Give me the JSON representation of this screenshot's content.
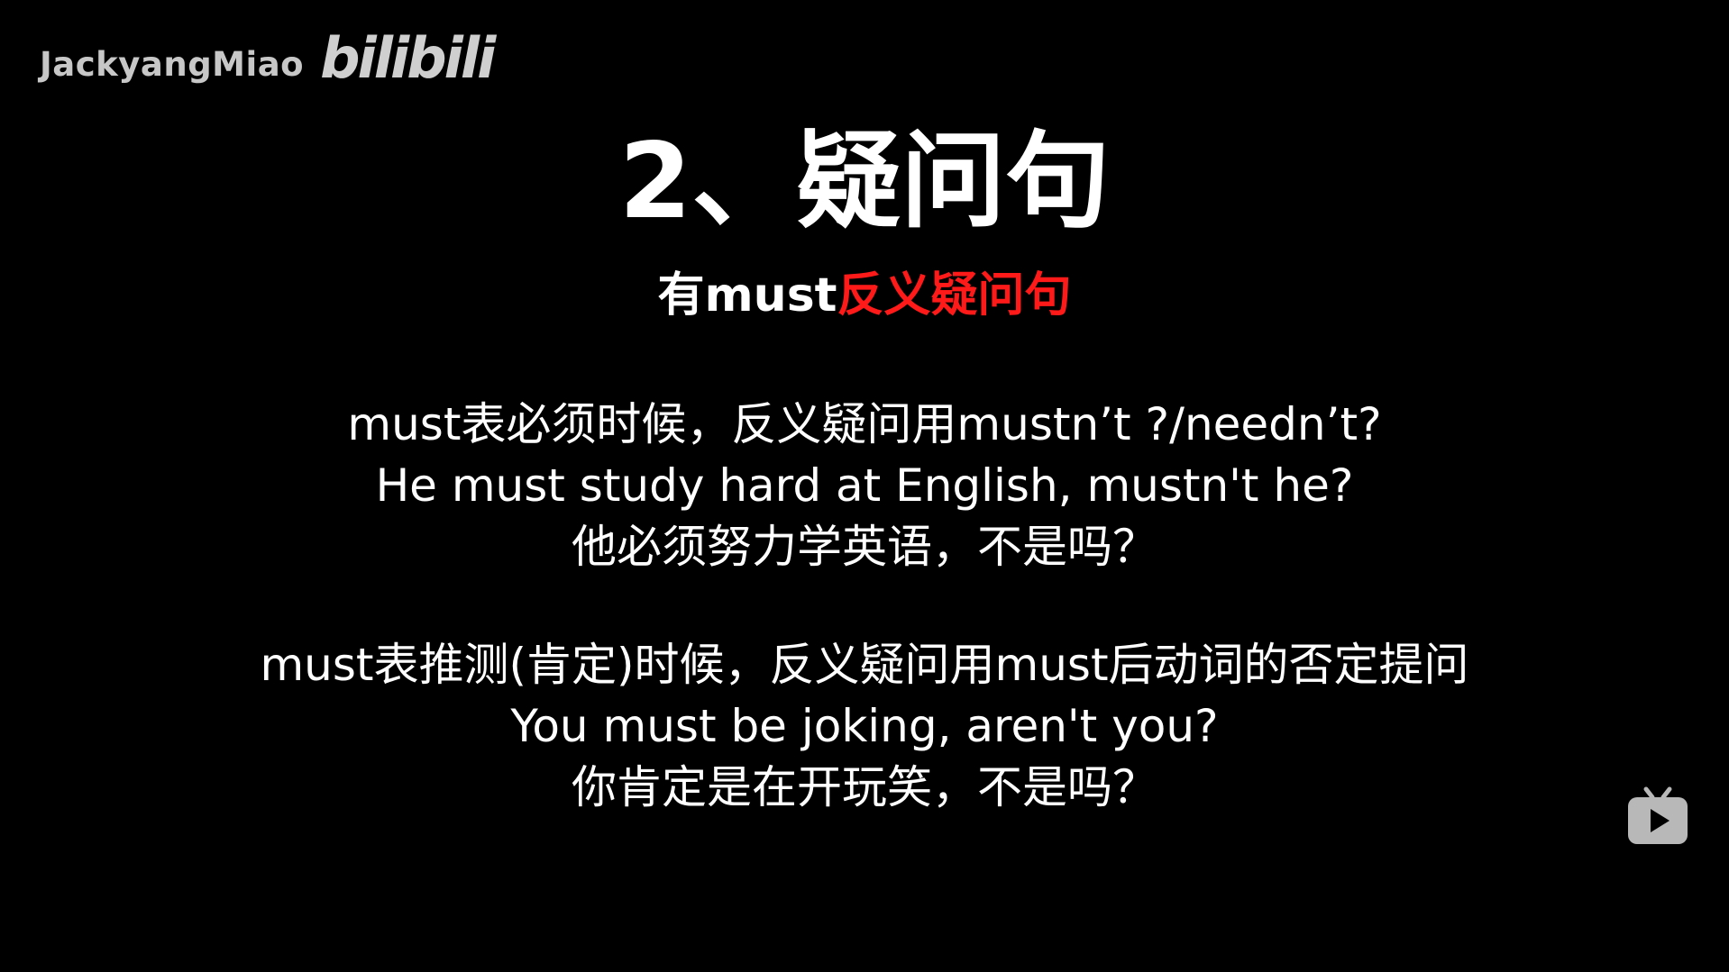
{
  "watermark": {
    "username": "JackyangMiao",
    "logo_text": "bilibili"
  },
  "slide": {
    "title": "2、疑问句",
    "subtitle_white": "有must",
    "subtitle_red": "反义疑问句",
    "block1": {
      "line1": "must表必须时候，反义疑问用mustn’t ?/needn’t?",
      "line2": "He must study hard at English, mustn't he?",
      "line3": "他必须努力学英语，不是吗？"
    },
    "block2": {
      "line1": "must表推测(肯定)时候，反义疑问用must后动词的否定提问",
      "line2": "You must be joking, aren't you?",
      "line3": "你肯定是在开玩笑，不是吗？"
    }
  },
  "icons": {
    "player": "bilibili-tv-play-icon"
  },
  "colors": {
    "background": "#000000",
    "text": "#ffffff",
    "accent_red": "#ff1a1a"
  }
}
